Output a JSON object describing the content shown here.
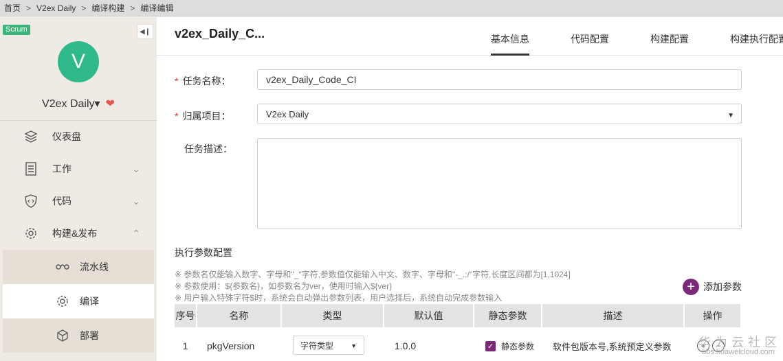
{
  "breadcrumb": [
    "首页",
    "V2ex Daily",
    "编译构建",
    "编译编辑"
  ],
  "breadcrumb_sep": ">",
  "sidebar": {
    "badge": "Scrum",
    "avatar_letter": "V",
    "project_name": "V2ex Daily▾",
    "items": [
      {
        "label": "仪表盘",
        "icon": "layers-icon"
      },
      {
        "label": "工作",
        "icon": "document-list-icon"
      },
      {
        "label": "代码",
        "icon": "shield-code-icon"
      },
      {
        "label": "构建&发布",
        "icon": "gear-icon"
      },
      {
        "label": "流水线",
        "icon": "pipeline-icon"
      },
      {
        "label": "编译",
        "icon": "gear-icon"
      },
      {
        "label": "部署",
        "icon": "cube-icon"
      }
    ]
  },
  "header": {
    "title": "v2ex_Daily_C...",
    "tabs": [
      "基本信息",
      "代码配置",
      "构建配置",
      "构建执行配置"
    ]
  },
  "form": {
    "task_name_label": "任务名称：",
    "task_name_value": "v2ex_Daily_Code_CI",
    "project_label": "归属项目：",
    "project_value": "V2ex Daily",
    "desc_label": "任务描述：",
    "desc_value": ""
  },
  "params": {
    "section_title": "执行参数配置",
    "hints": [
      "※ 参数名仅能输入数字、字母和\"_\"字符,参数值仅能输入中文、数字、字母和\"-_.:/\"字符,长度区间都为[1,1024]",
      "※ 参数使用：${参数名}，如参数名为ver，使用时输入${ver}",
      "※ 用户输入特殊字符$时，系统会自动弹出参数列表，用户选择后，系统自动完成参数输入"
    ],
    "add_label": "添加参数",
    "columns": [
      "序号",
      "名称",
      "类型",
      "默认值",
      "静态参数",
      "描述",
      "操作"
    ],
    "rows": [
      {
        "index": "1",
        "name": "pkgVersion",
        "type": "字符类型",
        "default": "1.0.0",
        "static_label": "静态参数",
        "static_checked": true,
        "desc": "软件包版本号,系统预定义参数"
      }
    ]
  },
  "watermark": {
    "line1": "华为云社区",
    "line2": "bbs.huaweicloud.com"
  },
  "colors": {
    "accent": "#7b2a7a",
    "avatar": "#2fb98a",
    "scrum": "#3cb37a",
    "required": "#d9322b"
  }
}
